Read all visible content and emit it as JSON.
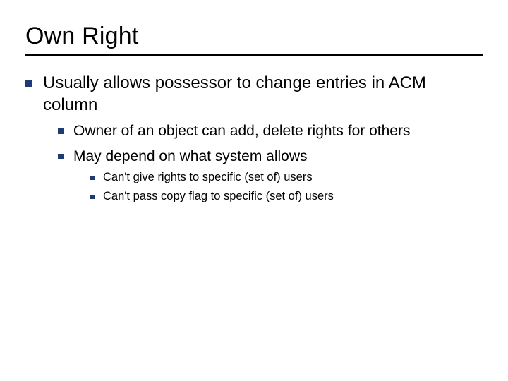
{
  "title": "Own Right",
  "bullets": {
    "l1_0": "Usually allows possessor to change entries in ACM column",
    "l2_0": "Owner of an object can add, delete rights for others",
    "l2_1": "May depend on what system allows",
    "l3_0": "Can't give rights to specific (set of) users",
    "l3_1": "Can't pass copy flag to specific (set of) users"
  }
}
